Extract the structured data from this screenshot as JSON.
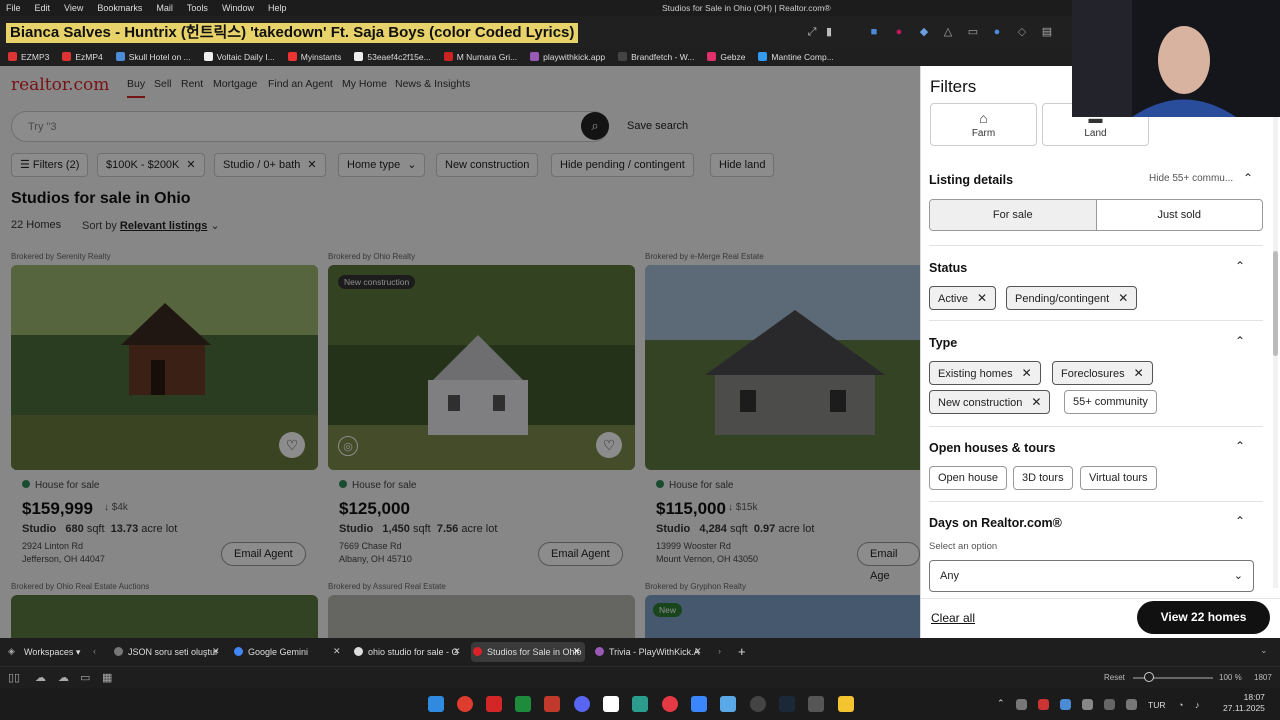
{
  "os_menu": {
    "items": [
      "File",
      "Edit",
      "View",
      "Bookmarks",
      "Mail",
      "Tools",
      "Window",
      "Help"
    ],
    "window_title": "Studios for Sale in Ohio (OH) | Realtor.com®"
  },
  "address_bar": {
    "text": "Bianca Salves - Huntrix (헌트릭스) 'takedown' Ft. Saja Boys (color Coded Lyrics)"
  },
  "bookmarks": [
    {
      "label": "EZMP3",
      "color": "#d33"
    },
    {
      "label": "EzMP4",
      "color": "#d33"
    },
    {
      "label": "Skull Hotel on ...",
      "color": "#4a8cd6"
    },
    {
      "label": "Voltaic Daily I...",
      "color": "#eee"
    },
    {
      "label": "Myinstants",
      "color": "#e33"
    },
    {
      "label": "53eaef4c2f15e...",
      "color": "#eee"
    },
    {
      "label": "M Numara Gri...",
      "color": "#c22"
    },
    {
      "label": "playwithkick.app",
      "color": "#9b59b6"
    },
    {
      "label": "Brandfetch - W...",
      "color": "#222"
    },
    {
      "label": "Gebze",
      "color": "#e1306c"
    },
    {
      "label": "Mantine Comp...",
      "color": "#339af0"
    }
  ],
  "site": {
    "logo": "realtor.com",
    "nav": [
      "Buy",
      "Sell",
      "Rent",
      "Mortgage",
      "Find an Agent",
      "My Home",
      "News & Insights"
    ],
    "search_placeholder": "Try \"3",
    "save_search": "Save search",
    "chips": [
      {
        "label": "Filters (2)",
        "x": false
      },
      {
        "label": "$100K - $200K",
        "x": true
      },
      {
        "label": "Studio / 0+ bath",
        "x": true
      },
      {
        "label": "Home type",
        "x": false
      },
      {
        "label": "New construction",
        "x": false
      },
      {
        "label": "Hide pending / contingent",
        "x": false
      },
      {
        "label": "Hide land",
        "x": false
      }
    ],
    "page_title": "Studios for sale in Ohio",
    "homes_count": "22 Homes",
    "sort_label": "Sort by",
    "sort_value": "Relevant listings"
  },
  "listings": [
    {
      "broker": "Brokered by Serenity Realty",
      "badge": "",
      "status": "House for sale",
      "price": "$159,999",
      "drop": "↓ $4k",
      "beds": "Studio",
      "sqft": "680",
      "sqft_unit": "sqft",
      "lot": "13.73",
      "lot_unit": "acre lot",
      "address1": "2924 Linton Rd",
      "address2": "Jefferson, OH 44047",
      "email": "Email Agent"
    },
    {
      "broker": "Brokered by Ohio Realty",
      "badge": "New construction",
      "status": "House for sale",
      "price": "$125,000",
      "drop": "",
      "beds": "Studio",
      "sqft": "1,450",
      "sqft_unit": "sqft",
      "lot": "7.56",
      "lot_unit": "acre lot",
      "address1": "7669 Chase Rd",
      "address2": "Albany, OH 45710",
      "email": "Email Agent"
    },
    {
      "broker": "Brokered by e-Merge Real Estate",
      "badge": "",
      "status": "House for sale",
      "price": "$115,000",
      "drop": "↓ $15k",
      "beds": "Studio",
      "sqft": "4,284",
      "sqft_unit": "sqft",
      "lot": "0.97",
      "lot_unit": "acre lot",
      "address1": "13999 Wooster Rd",
      "address2": "Mount Vernon, OH 43050",
      "email": "Email Age"
    }
  ],
  "second_row_brokers": [
    "Brokered by Ohio Real Estate Auctions",
    "Brokered by Assured Real Estate",
    "Brokered by Gryphon Realty"
  ],
  "second_row_badge": "New",
  "filters": {
    "title": "Filters",
    "tiles": [
      "Farm",
      "Land"
    ],
    "listing_details": "Listing details",
    "hide55": "Hide 55+ commu...",
    "segments": [
      "For sale",
      "Just sold"
    ],
    "status_title": "Status",
    "status_chips": [
      "Active",
      "Pending/contingent"
    ],
    "type_title": "Type",
    "type_chips": [
      "Existing homes",
      "Foreclosures",
      "New construction",
      "55+ community"
    ],
    "open_title": "Open houses & tours",
    "open_chips": [
      "Open house",
      "3D tours",
      "Virtual tours"
    ],
    "days_title": "Days on Realtor.com®",
    "select_option": "Select an option",
    "dropdown_value": "Any",
    "clear_all": "Clear all",
    "view_homes": "View 22 homes"
  },
  "tabs": [
    {
      "label": "Workspaces",
      "active": false,
      "color": "#888"
    },
    {
      "label": "JSON soru seti oluştur",
      "active": false,
      "color": "#777"
    },
    {
      "label": "Google Gemini",
      "active": false,
      "color": "#4285f4"
    },
    {
      "label": "ohio studio for sale - G",
      "active": false,
      "color": "#ddd"
    },
    {
      "label": "Studios for Sale in Ohio",
      "active": true,
      "color": "#d92228"
    },
    {
      "label": "Trivia - PlayWithKick.A",
      "active": false,
      "color": "#9b59b6"
    }
  ],
  "status_strip": {
    "reset": "Reset",
    "zoom": "100 %",
    "fps": "1807"
  },
  "taskbar": {
    "lang": "TUR",
    "time": "18:07",
    "date": "27.11.2025"
  }
}
